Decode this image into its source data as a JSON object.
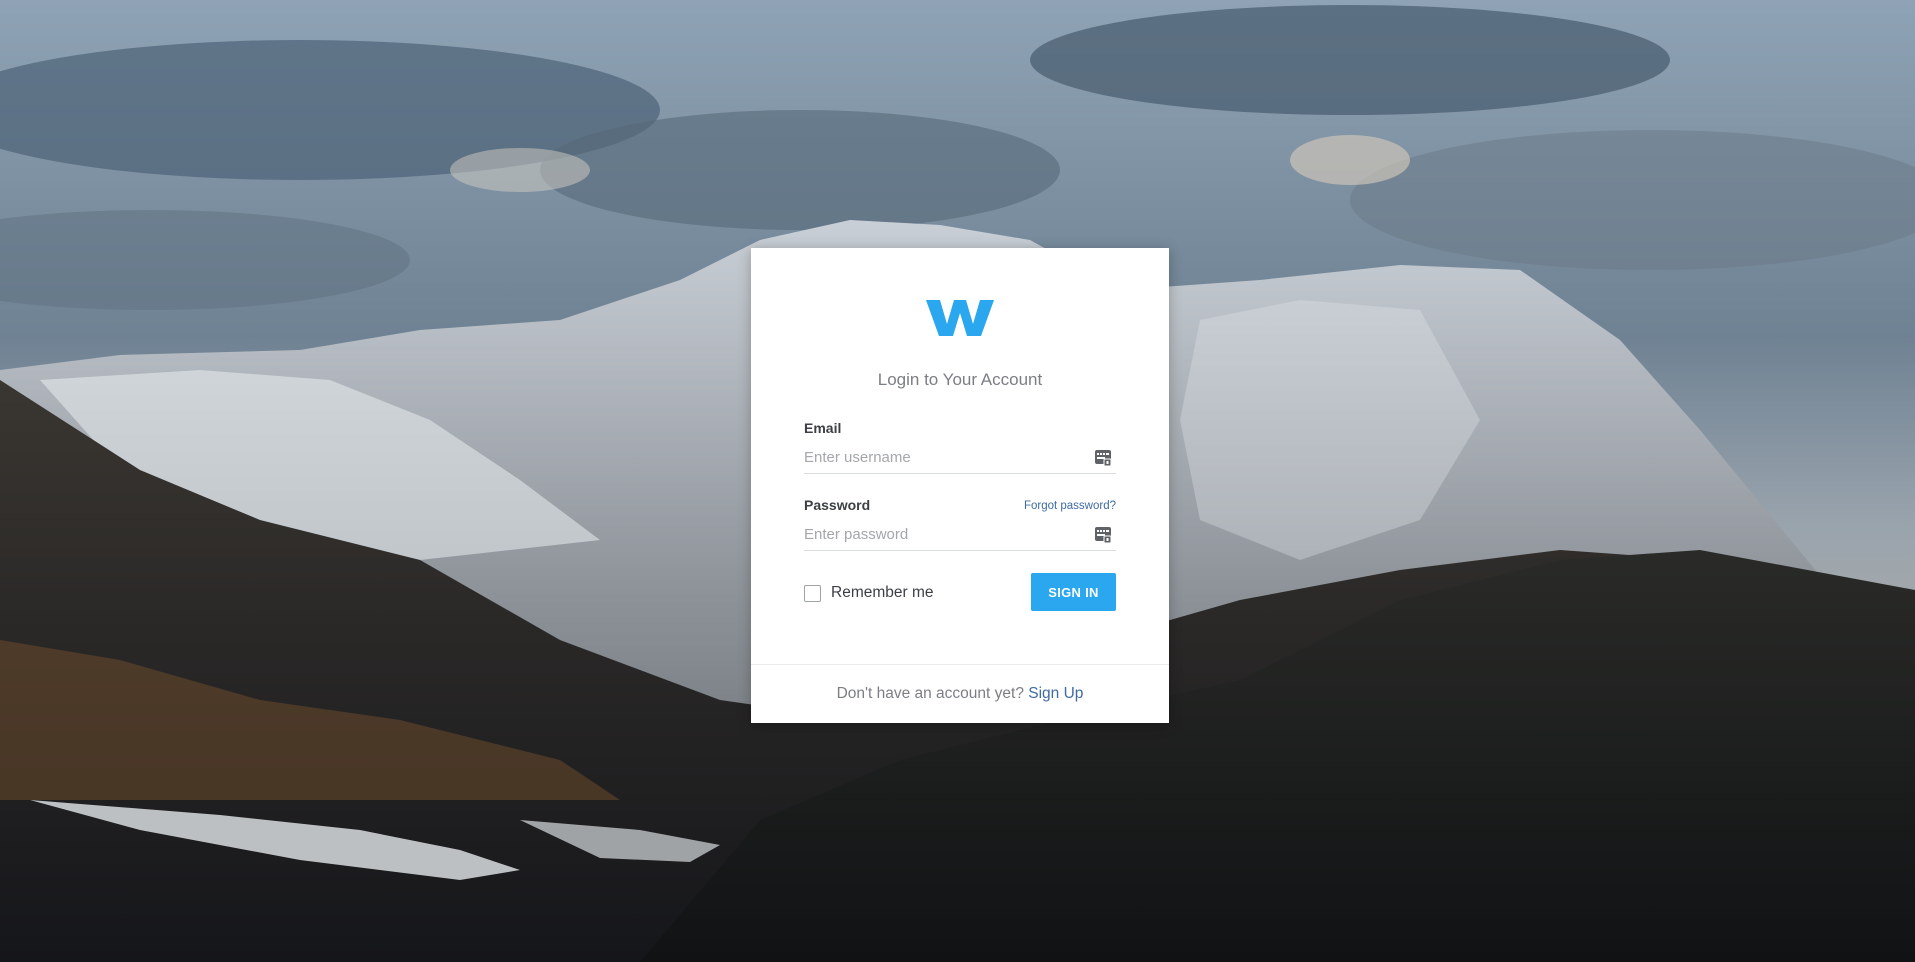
{
  "background": {
    "description_icon": "mountain-landscape-background"
  },
  "brand": {
    "logo_icon": "w-logo-icon",
    "color": "#2aa7ee"
  },
  "login": {
    "title": "Login to Your Account",
    "email_label": "Email",
    "email_placeholder": "Enter username",
    "email_value": "",
    "password_label": "Password",
    "password_placeholder": "Enter password",
    "password_value": "",
    "forgot_password": "Forgot password?",
    "remember_me": "Remember me",
    "remember_checked": false,
    "sign_in": "SIGN IN",
    "field_icon": "keyboard-icon"
  },
  "footer": {
    "prompt": "Don't have an account yet?",
    "signup_link": "Sign Up"
  }
}
